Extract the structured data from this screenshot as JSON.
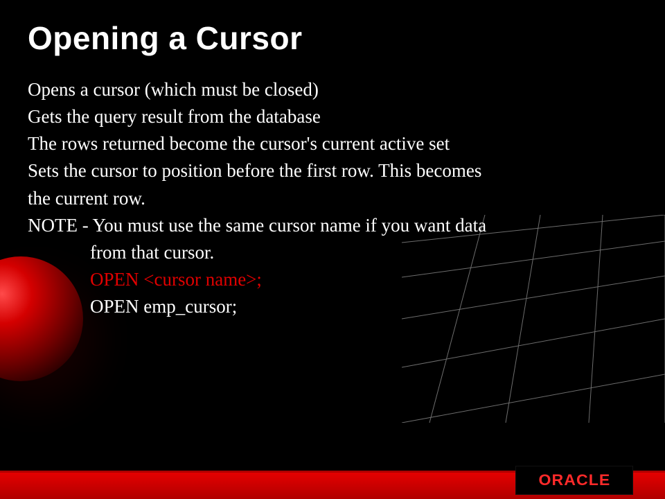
{
  "title": "Opening a Cursor",
  "body": {
    "l1": "Opens a cursor (which must be closed)",
    "l2": "Gets the query result from the database",
    "l3": "The rows returned become the cursor's current active set",
    "l4": "Sets the cursor to position before the first row. This becomes",
    "l5": "the current row.",
    "l6": "NOTE - You must use the same cursor name if you want data",
    "l7": "from that cursor.",
    "syntax": "OPEN <cursor name>;",
    "example": "OPEN emp_cursor;"
  },
  "brand": "ORACLE"
}
